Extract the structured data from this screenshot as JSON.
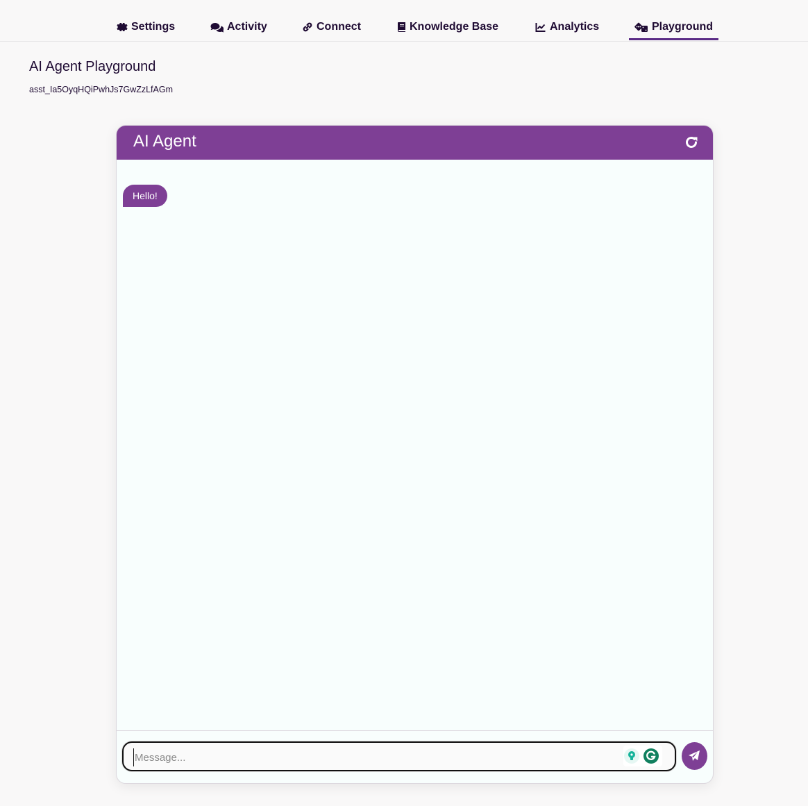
{
  "nav": {
    "tabs": [
      {
        "label": "Settings",
        "icon": "gear-icon"
      },
      {
        "label": "Activity",
        "icon": "comments-icon"
      },
      {
        "label": "Connect",
        "icon": "link-icon"
      },
      {
        "label": "Knowledge Base",
        "icon": "book-icon"
      },
      {
        "label": "Analytics",
        "icon": "chart-line-icon"
      },
      {
        "label": "Playground",
        "icon": "dice-icon",
        "active": true
      }
    ]
  },
  "page": {
    "title": "AI Agent Playground",
    "assistant_id": "asst_Ia5OyqHQiPwhJs7GwZzLfAGm"
  },
  "chat": {
    "title": "AI Agent",
    "refresh_icon": "refresh-icon",
    "messages": [
      {
        "role": "assistant",
        "text": "Hello!"
      }
    ],
    "input": {
      "placeholder": "Message...",
      "value": ""
    },
    "send_icon": "paper-plane-icon",
    "accent_color": "#7e3f95"
  }
}
